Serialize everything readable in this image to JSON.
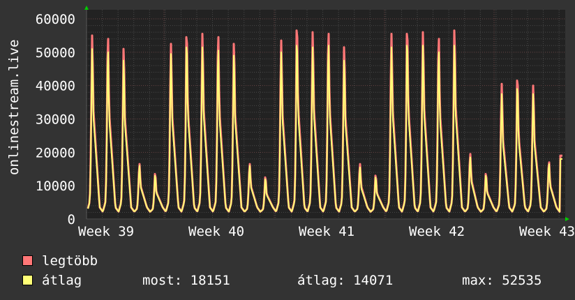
{
  "chart_data": {
    "type": "line",
    "title": "",
    "ylabel": "onlinestream.live",
    "xlabel": "",
    "ylim": [
      0,
      60000
    ],
    "yticks": [
      "0",
      "10000",
      "20000",
      "30000",
      "40000",
      "50000",
      "60000"
    ],
    "xticks": [
      "Week 39",
      "Week 40",
      "Week 41",
      "Week 42",
      "Week 43"
    ],
    "grid": true,
    "x_unit": "day",
    "series": [
      {
        "name": "legtöbb",
        "color": "#ff7777",
        "daily_peaks": [
          55000,
          54000,
          51000,
          16500,
          13500,
          52500,
          54500,
          55500,
          54500,
          52500,
          16500,
          12500,
          53500,
          56500,
          56000,
          55500,
          51500,
          16500,
          13000,
          55500,
          55500,
          56000,
          54000,
          56500,
          19500,
          13500,
          40500,
          41500,
          40000,
          17000,
          19000
        ]
      },
      {
        "name": "átlag",
        "color": "#ffff77",
        "daily_peaks": [
          51000,
          50000,
          47500,
          16000,
          13000,
          49500,
          51500,
          51500,
          50500,
          49000,
          16000,
          12000,
          50000,
          52000,
          51500,
          52000,
          47500,
          15500,
          12500,
          51500,
          52000,
          52000,
          50000,
          52000,
          18500,
          13000,
          37500,
          39000,
          37500,
          16500,
          18000
        ]
      }
    ]
  },
  "legend": {
    "max_label": "legtöbb",
    "avg_label": "átlag",
    "now": "most: 18151",
    "avg": "átlag: 14071",
    "max": "max: 52535"
  }
}
